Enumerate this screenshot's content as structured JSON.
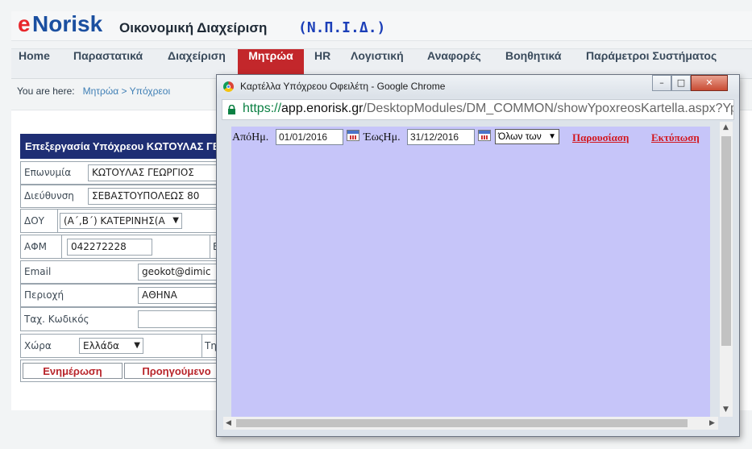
{
  "brand": {
    "logo_e": "e",
    "logo_rest": "Norisk",
    "subtitle": "Οικονομική Διαχείριση",
    "org": "(Ν.Π.Ι.Δ.)"
  },
  "nav": {
    "items": [
      "Home",
      "Παραστατικά",
      "Διαχείριση",
      "Μητρώα",
      "HR",
      "Λογιστική",
      "Αναφορές",
      "Βοηθητικά",
      "Παράμετροι Συστήματος"
    ],
    "active": "Μητρώα"
  },
  "breadcrumb": {
    "prefix": "You are here:",
    "path1": "Μητρώα",
    "sep": ">",
    "path2": "Υπόχρεοι"
  },
  "form": {
    "header": "Επεξεργασία Υπόχρεου ΚΩΤΟΥΛΑΣ ΓΕΩΡΓΙΟΣ",
    "name_label": "Επωνυμία",
    "name_value": "ΚΩΤΟΥΛΑΣ ΓΕΩΡΓΙΟΣ",
    "address_label": "Διεύθυνση",
    "address_value": "ΣΕΒΑΣΤΟΥΠΟΛΕΩΣ 80",
    "doy_label": "ΔΟΥ",
    "doy_value": "(Α΄,Β΄) ΚΑΤΕΡΙΝΗΣ(Α",
    "afm_label": "ΑΦΜ",
    "afm_value": "042272228",
    "afm_extra": "Ε",
    "email_label": "Email",
    "email_value": "geokot@dimic",
    "region_label": "Περιοχή",
    "region_value": "ΑΘΗΝΑ",
    "zip_label": "Ταχ. Κωδικός",
    "zip_value": "",
    "country_label": "Χώρα",
    "country_value": "Ελλάδα",
    "phone_label_part": "Τη",
    "update_button": "Ενημέρωση",
    "prev_button": "Προηγούμενο"
  },
  "popup": {
    "title": "Καρτέλλα Υπόχρεου Οφειλέτη - Google Chrome",
    "url_scheme": "https://",
    "url_host": "app.enorisk.gr",
    "url_path": "/DesktopModules/DM_COMMON/showYpoxreosKartella.aspx?Yp",
    "from_label": "ΑπόΗμ.",
    "from_value": "01/01/2016",
    "to_label": "ΈωςΗμ.",
    "to_value": "31/12/2016",
    "filter_value": "Όλων των",
    "show_link": "Παρουσίαση",
    "print_link": "Εκτύπωση",
    "controls": {
      "minimize": "–",
      "maximize": "□",
      "close": "✕"
    },
    "content_bg": "#c6c5f9"
  },
  "colors": {
    "brand_red": "#e8262b",
    "brand_blue": "#1b4fa0",
    "nav_active": "#c3272b",
    "form_header": "#1e2e74"
  }
}
